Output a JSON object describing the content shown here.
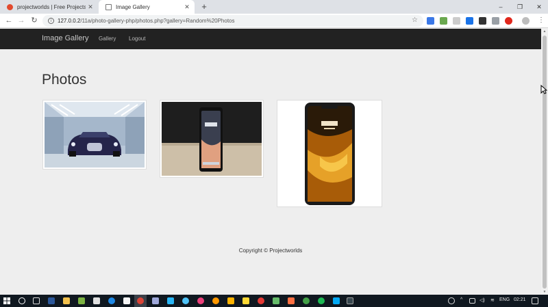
{
  "browser": {
    "tabs": [
      {
        "title": "projectworlds | Free Projects and"
      },
      {
        "title": "Image Gallery"
      }
    ],
    "new_tab": "+",
    "url": {
      "host": "127.0.0.2",
      "path": "/11a/photo-gallery-php/photos.php?gallery=Random%20Photos"
    },
    "icons": {
      "back": "←",
      "forward": "→",
      "reload": "↻",
      "info": "i",
      "star": "☆",
      "close_tab": "✕",
      "minimize": "–",
      "restore": "❐",
      "close_window": "✕",
      "menu": "⋮"
    }
  },
  "site": {
    "brand": "Image Gallery",
    "nav": [
      {
        "label": "Gallery"
      },
      {
        "label": "Logout"
      }
    ],
    "heading": "Photos",
    "photos": [
      {
        "subject": "supercar",
        "colors": {
          "bg": "#9fb3c8",
          "car": "#24233f"
        }
      },
      {
        "subject": "phone-on-table",
        "colors": {
          "bg": "#2a2a2a",
          "table": "#cdbfa8"
        }
      },
      {
        "subject": "phone-front",
        "colors": {
          "body": "#1a1a1a",
          "screen": "#d08a1c"
        }
      }
    ],
    "footer": "Copyright © Projectworlds"
  },
  "taskbar": {
    "language": "ENG",
    "time": "02:21",
    "accent": "#0078d7"
  }
}
